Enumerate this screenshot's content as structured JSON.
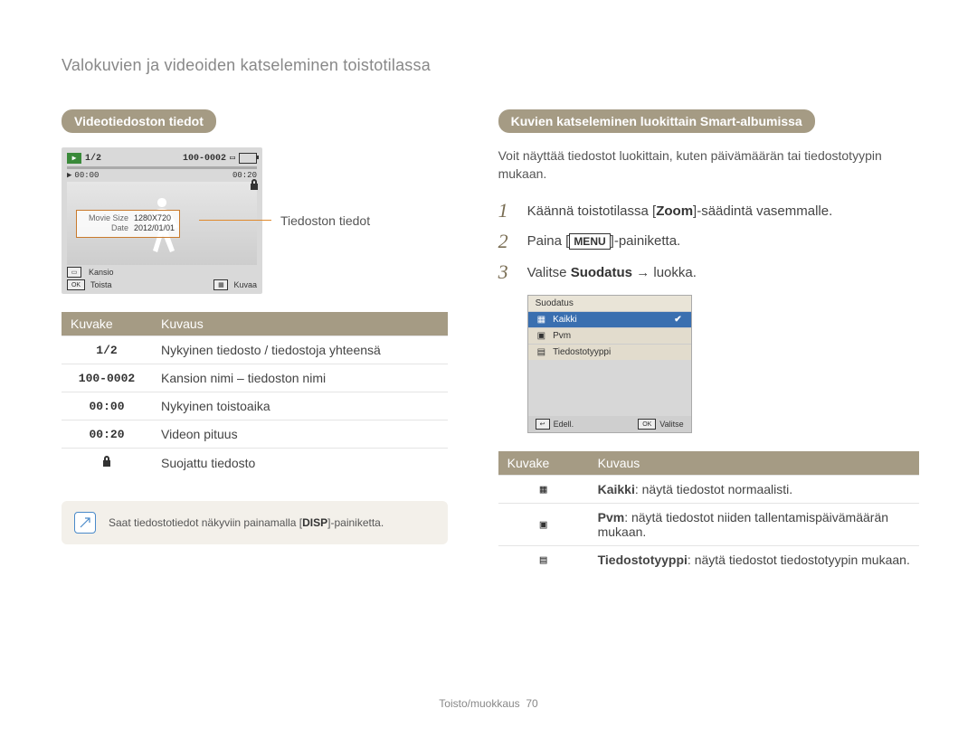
{
  "header": {
    "breadcrumb": "Valokuvien ja videoiden katseleminen toistotilassa"
  },
  "left": {
    "pill": "Videotiedoston tiedot",
    "callout": "Tiedoston tiedot",
    "screen": {
      "counter": "1/2",
      "filename": "100-0002",
      "time_cur": "00:00",
      "time_total": "00:20",
      "info": {
        "k1": "Movie Size",
        "v1": "1280X720",
        "k2": "Date",
        "v2": "2012/01/01"
      },
      "bb": {
        "folder": "Kansio",
        "play": "Toista",
        "capture": "Kuvaa"
      }
    },
    "table": {
      "hdr_icon": "Kuvake",
      "hdr_desc": "Kuvaus",
      "rows": [
        {
          "icon": "1/2",
          "desc": "Nykyinen tiedosto / tiedostoja yhteensä"
        },
        {
          "icon": "100-0002",
          "desc": "Kansion nimi – tiedoston nimi"
        },
        {
          "icon": "00:00",
          "desc": "Nykyinen toistoaika"
        },
        {
          "icon": "00:20",
          "desc": "Videon pituus"
        },
        {
          "icon": "lock",
          "desc": "Suojattu tiedosto"
        }
      ]
    },
    "note": {
      "pre": "Saat tiedostotiedot näkyviin painamalla [",
      "bold": "DISP",
      "post": "]-painiketta."
    }
  },
  "right": {
    "pill": "Kuvien katseleminen luokittain Smart-albumissa",
    "intro": "Voit näyttää tiedostot luokittain, kuten päivämäärän tai tiedostotyypin mukaan.",
    "steps": [
      {
        "n": "1",
        "pre": "Käännä toistotilassa [",
        "bold": "Zoom",
        "post": "]-säädintä vasemmalle."
      },
      {
        "n": "2",
        "pre": "Paina [",
        "bold": "MENU",
        "post": "]-painiketta."
      },
      {
        "n": "3",
        "pre": "Valitse ",
        "bold": "Suodatus",
        "post": "luokka."
      }
    ],
    "filter": {
      "header": "Suodatus",
      "options": [
        "Kaikki",
        "Pvm",
        "Tiedostotyyppi"
      ],
      "footer": {
        "back": "Edell.",
        "select": "Valitse"
      }
    },
    "table": {
      "hdr_icon": "Kuvake",
      "hdr_desc": "Kuvaus",
      "rows": [
        {
          "bold": "Kaikki",
          "desc": ": näytä tiedostot normaalisti."
        },
        {
          "bold": "Pvm",
          "desc": ": näytä tiedostot niiden tallentamispäivämäärän mukaan."
        },
        {
          "bold": "Tiedostotyyppi",
          "desc": ": näytä tiedostot tiedostotyypin mukaan."
        }
      ]
    }
  },
  "footer": {
    "section": "Toisto/muokkaus",
    "page": "70"
  }
}
